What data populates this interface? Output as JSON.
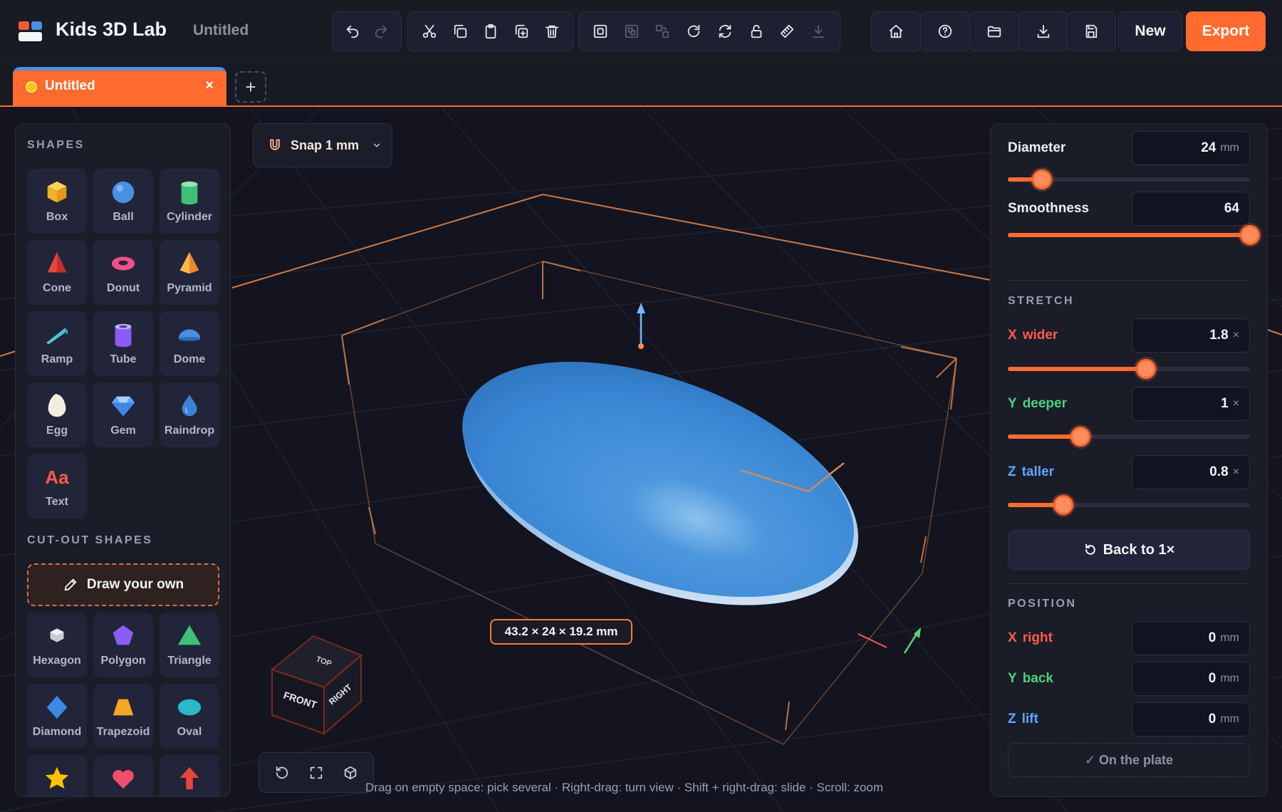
{
  "app": {
    "title": "Kids 3D Lab",
    "document_title": "Untitled"
  },
  "toolbar": {
    "edit_tools": [
      "undo-icon",
      "redo-icon"
    ],
    "clipboard_tools": [
      "cut-icon",
      "copy-icon",
      "paste-icon",
      "duplicate-icon",
      "delete-icon"
    ],
    "object_tools": [
      "group-icon",
      "ungroup-icon",
      "align-icon",
      "rotate-icon",
      "mirror-icon",
      "lock-icon",
      "measure-icon",
      "drop-to-plate-icon"
    ],
    "nav_buttons": [
      "home-icon",
      "help-icon",
      "open-folder-icon",
      "download-icon",
      "save-icon"
    ],
    "new_label": "New",
    "export_label": "Export"
  },
  "tabs": [
    {
      "label": "Untitled",
      "close": "×"
    }
  ],
  "tab_add": "+",
  "snap": {
    "label": "Snap 1 mm"
  },
  "left_panel": {
    "shapes_title": "SHAPES",
    "shapes": [
      {
        "label": "Box",
        "icon": "box-icon"
      },
      {
        "label": "Ball",
        "icon": "ball-icon"
      },
      {
        "label": "Cylinder",
        "icon": "cylinder-icon"
      },
      {
        "label": "Cone",
        "icon": "cone-icon"
      },
      {
        "label": "Donut",
        "icon": "donut-icon"
      },
      {
        "label": "Pyramid",
        "icon": "pyramid-icon"
      },
      {
        "label": "Ramp",
        "icon": "ramp-icon"
      },
      {
        "label": "Tube",
        "icon": "tube-icon"
      },
      {
        "label": "Dome",
        "icon": "dome-icon"
      },
      {
        "label": "Egg",
        "icon": "egg-icon"
      },
      {
        "label": "Gem",
        "icon": "gem-icon"
      },
      {
        "label": "Raindrop",
        "icon": "raindrop-icon"
      },
      {
        "label": "Text",
        "icon": "text-icon",
        "glyph": "Aa"
      }
    ],
    "cutout_title": "CUT-OUT SHAPES",
    "draw_own_label": "Draw your own",
    "cutouts": [
      {
        "label": "Hexagon",
        "icon": "hexagon-icon"
      },
      {
        "label": "Polygon",
        "icon": "polygon-icon"
      },
      {
        "label": "Triangle",
        "icon": "triangle-icon"
      },
      {
        "label": "Diamond",
        "icon": "diamond-icon"
      },
      {
        "label": "Trapezoid",
        "icon": "trapezoid-icon"
      },
      {
        "label": "Oval",
        "icon": "oval-icon"
      },
      {
        "label": "",
        "icon": "star-icon"
      },
      {
        "label": "",
        "icon": "heart-icon"
      },
      {
        "label": "",
        "icon": "arrow-icon"
      }
    ]
  },
  "viewport": {
    "dimensions_label": "43.2 × 24 × 19.2 mm",
    "view_cube": {
      "top": "TOP",
      "front": "FRONT",
      "right": "RIGHT"
    },
    "hint": "Drag on empty space: pick several · Right-drag: turn view · Shift + right-drag: slide · Scroll: zoom",
    "object_color": "#3a86d4",
    "selection_color": "#ff8c4a"
  },
  "properties": {
    "diameter": {
      "label": "Diameter",
      "value": "24",
      "unit": "mm",
      "slider_fraction": 0.14
    },
    "smoothness": {
      "label": "Smoothness",
      "value": "64",
      "slider_fraction": 1.0
    },
    "stretch_title": "STRETCH",
    "stretch": [
      {
        "axis": "X",
        "label": "wider",
        "value": "1.8",
        "unit": "×",
        "color": "#ff5a4a",
        "slider_fraction": 0.57
      },
      {
        "axis": "Y",
        "label": "deeper",
        "value": "1",
        "unit": "×",
        "color": "#4cd17a",
        "slider_fraction": 0.3
      },
      {
        "axis": "Z",
        "label": "taller",
        "value": "0.8",
        "unit": "×",
        "color": "#5aa8ff",
        "slider_fraction": 0.23
      }
    ],
    "back_label": "Back to 1×",
    "position_title": "POSITION",
    "position": [
      {
        "axis": "X",
        "label": "right",
        "value": "0",
        "unit": "mm",
        "color": "#ff5a4a"
      },
      {
        "axis": "Y",
        "label": "back",
        "value": "0",
        "unit": "mm",
        "color": "#4cd17a"
      },
      {
        "axis": "Z",
        "label": "lift",
        "value": "0",
        "unit": "mm",
        "color": "#5aa8ff"
      }
    ],
    "on_plate_label": "✓ On the plate"
  },
  "colors": {
    "accent": "#ff6a2f",
    "background": "#14151e",
    "panel": "#1a1c28"
  }
}
